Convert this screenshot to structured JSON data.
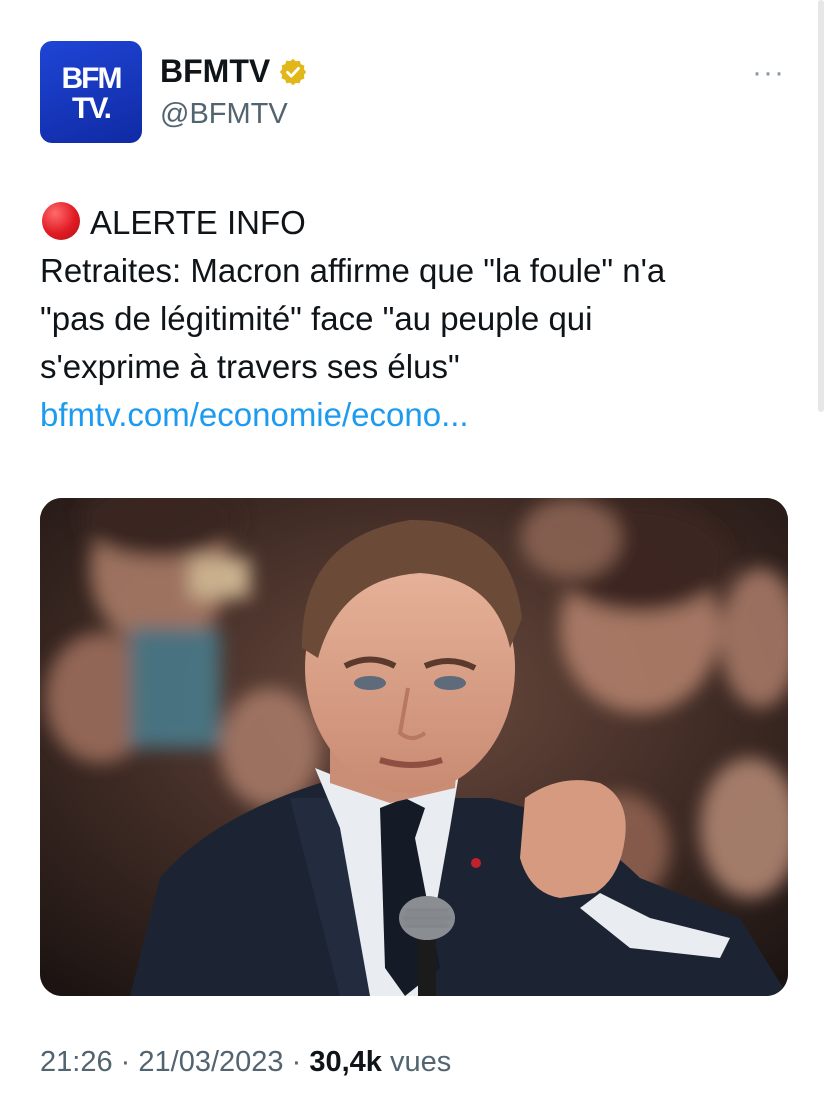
{
  "account": {
    "avatar_text_line1": "BFM",
    "avatar_text_line2": "TV.",
    "display_name": "BFMTV",
    "handle": "@BFMTV",
    "verified_badge_color": "#e2b719",
    "avatar_color": "#1a3fd0"
  },
  "menu": {
    "more_label": "···"
  },
  "tweet": {
    "alert_icon": "red-circle-icon",
    "alert_label": "ALERTE INFO",
    "lines": [
      "Retraites: Macron affirme que \"la foule\" n'a",
      "\"pas de légitimité\" face \"au peuple qui",
      "s'exprime à travers ses élus\""
    ],
    "link": "bfmtv.com/economie/econo..."
  },
  "media": {
    "description_icon": "photo-macron-speaking"
  },
  "meta": {
    "time": "21:26",
    "separator": "·",
    "date": "21/03/2023",
    "views_count": "30,4k",
    "views_label": "vues"
  },
  "colors": {
    "link": "#1d9bf0",
    "secondary_text": "#536471",
    "primary_text": "#0f1419"
  }
}
